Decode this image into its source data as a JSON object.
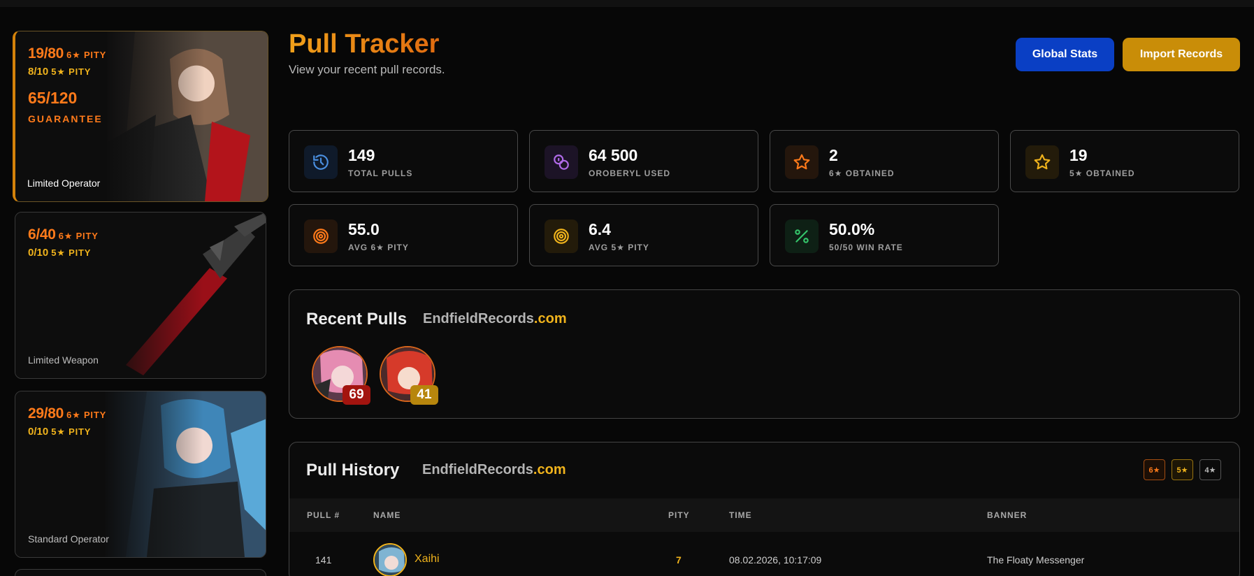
{
  "sidebar": {
    "banners": [
      {
        "pity6": "19/80",
        "pity6_label": "6★ PITY",
        "pity5": "8/10",
        "pity5_label": "5★ PITY",
        "guarantee": "65/120",
        "guarantee_label": "GUARANTEE",
        "type": "Limited Operator"
      },
      {
        "pity6": "6/40",
        "pity6_label": "6★ PITY",
        "pity5": "0/10",
        "pity5_label": "5★ PITY",
        "type": "Limited Weapon"
      },
      {
        "pity6": "29/80",
        "pity6_label": "6★ PITY",
        "pity5": "0/10",
        "pity5_label": "5★ PITY",
        "type": "Standard Operator"
      }
    ]
  },
  "header": {
    "title": "Pull Tracker",
    "subtitle": "View your recent pull records.",
    "global_stats": "Global Stats",
    "import_records": "Import Records"
  },
  "stats": [
    {
      "value": "149",
      "label": "TOTAL PULLS",
      "icon": "history-icon",
      "color": "#4a8fe0"
    },
    {
      "value": "64 500",
      "label": "OROBERYL USED",
      "icon": "coins-icon",
      "color": "#b06ae8"
    },
    {
      "value": "2",
      "label": "6★ OBTAINED",
      "icon": "star-outline-icon",
      "color": "#ff7a1a"
    },
    {
      "value": "19",
      "label": "5★ OBTAINED",
      "icon": "star-outline-icon",
      "color": "#f0b31c"
    },
    {
      "value": "55.0",
      "label": "AVG 6★ PITY",
      "icon": "target-icon",
      "color": "#ff7a1a"
    },
    {
      "value": "6.4",
      "label": "AVG 5★ PITY",
      "icon": "target-icon",
      "color": "#f0b31c"
    },
    {
      "value": "50.0%",
      "label": "50/50 WIN RATE",
      "icon": "percent-icon",
      "color": "#34c46a"
    }
  ],
  "recent": {
    "title": "Recent Pulls",
    "brand_main": "EndfieldRecords",
    "brand_tld": ".com",
    "pulls": [
      {
        "pity": "69",
        "badge_color": "#a3140f"
      },
      {
        "pity": "41",
        "badge_color": "#b7860d"
      }
    ]
  },
  "history": {
    "title": "Pull History",
    "brand_main": "EndfieldRecords",
    "brand_tld": ".com",
    "filters": [
      "6★",
      "5★",
      "4★"
    ],
    "columns": [
      "PULL #",
      "NAME",
      "PITY",
      "TIME",
      "BANNER"
    ],
    "rows": [
      {
        "pull": "141",
        "name": "Xaihi",
        "pity": "7",
        "time": "08.02.2026, 10:17:09",
        "banner": "The Floaty Messenger"
      }
    ]
  }
}
